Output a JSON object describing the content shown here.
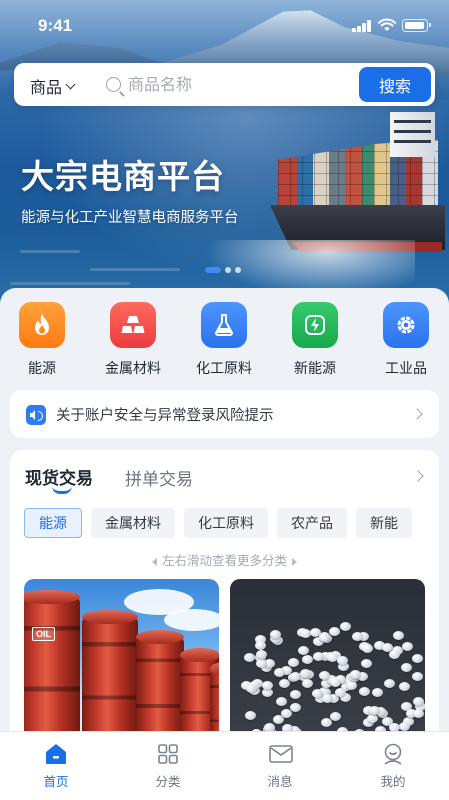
{
  "status_bar": {
    "time": "9:41"
  },
  "search": {
    "category": "商品",
    "placeholder": "商品名称",
    "button_label": "搜索"
  },
  "hero": {
    "title": "大宗电商平台",
    "subtitle": "能源与化工产业智慧电商服务平台",
    "slide_count": 3,
    "active_slide": 1
  },
  "categories": [
    {
      "label": "能源",
      "icon": "flame-icon",
      "color": "#ff8a1f"
    },
    {
      "label": "金属材料",
      "icon": "metal-bars-icon",
      "color": "#f2484a"
    },
    {
      "label": "化工原料",
      "icon": "flask-icon",
      "color": "#2f7cf0"
    },
    {
      "label": "新能源",
      "icon": "lightning-icon",
      "color": "#22b55a"
    },
    {
      "label": "工业品",
      "icon": "gear-icon",
      "color": "#2f7cf0"
    }
  ],
  "notice": {
    "text": "关于账户安全与异常登录风险提示"
  },
  "trade": {
    "tabs": [
      {
        "label": "现货交易",
        "active": true
      },
      {
        "label": "拼单交易",
        "active": false
      }
    ],
    "subcategories": [
      "能源",
      "金属材料",
      "化工原料",
      "农产品",
      "新能"
    ],
    "active_subcategory": "能源",
    "swipe_hint": "左右滑动查看更多分类",
    "products": [
      {
        "image": "oil-barrels",
        "barrel_label": "OIL"
      },
      {
        "image": "plastic-pellets"
      }
    ]
  },
  "tabbar": [
    {
      "label": "首页",
      "icon": "home-icon",
      "active": true
    },
    {
      "label": "分类",
      "icon": "grid-icon",
      "active": false
    },
    {
      "label": "消息",
      "icon": "mail-icon",
      "active": false
    },
    {
      "label": "我的",
      "icon": "user-icon",
      "active": false
    }
  ],
  "colors": {
    "accent": "#1a6fe8",
    "background": "#eef2f7"
  }
}
